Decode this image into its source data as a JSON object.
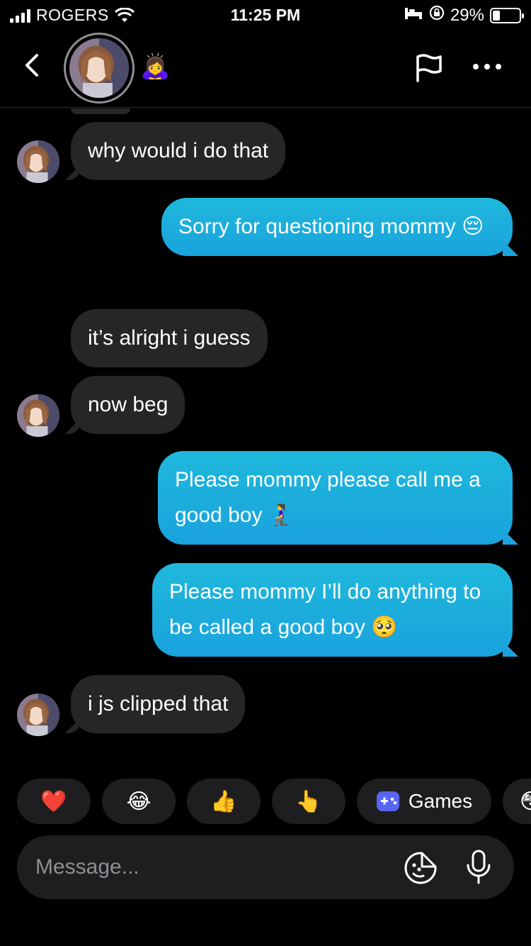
{
  "status_bar": {
    "carrier": "ROGERS",
    "time": "11:25 PM",
    "battery": "29%",
    "battery_level": 0.29
  },
  "header": {
    "status_emoji": "🙇‍♀️",
    "icons": [
      "back-chevron-icon",
      "flag-icon",
      "more-dots-icon"
    ]
  },
  "messages": [
    {
      "direction": "incoming",
      "text": "why would i do that",
      "show_avatar": true
    },
    {
      "direction": "outgoing",
      "text": "Sorry for questioning mommy 😔"
    },
    {
      "direction": "incoming",
      "text": "it’s alright i guess",
      "show_avatar": false
    },
    {
      "direction": "incoming",
      "text": "now beg",
      "show_avatar": true
    },
    {
      "direction": "outgoing",
      "text": "Please mommy please call me a good boy 🧎‍♀️"
    },
    {
      "direction": "outgoing",
      "text": "Please mommy I’ll do anything to be called a good boy 🥺"
    },
    {
      "direction": "incoming",
      "text": "i js clipped that",
      "show_avatar": true
    }
  ],
  "quick_reactions": [
    {
      "emoji": "❤️"
    },
    {
      "emoji": "😂"
    },
    {
      "emoji": "👍"
    },
    {
      "emoji": "👆"
    },
    {
      "label": "Games",
      "icon": "gamepad-icon"
    },
    {
      "emoji": "😳"
    }
  ],
  "composer": {
    "placeholder": "Message...",
    "icons": [
      "sticker-icon",
      "microphone-icon"
    ]
  },
  "colors": {
    "background": "#000000",
    "incoming_bubble": "#262628",
    "outgoing_bubble_top": "#1fb8dc",
    "outgoing_bubble_bottom": "#1aa3dd",
    "chip_bg": "#1e1e20",
    "games_icon": "#5865f2"
  }
}
